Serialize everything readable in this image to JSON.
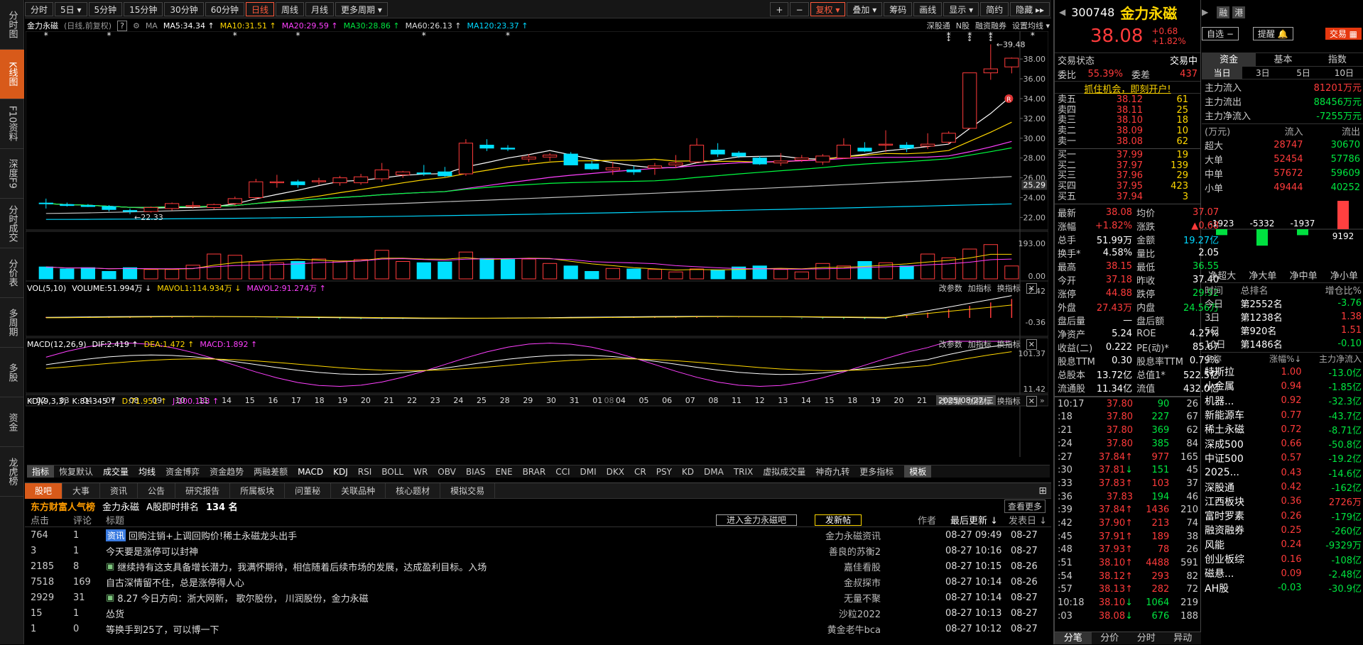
{
  "left_tabs": [
    "分时图",
    "K线图",
    "F10资料",
    "深度F9",
    "分时成交",
    "分价表",
    "多周期",
    "多股",
    "资金",
    "龙虎榜"
  ],
  "toolbar": {
    "periods": [
      "分时",
      "5日 ▾",
      "5分钟",
      "15分钟",
      "30分钟",
      "60分钟",
      "日线",
      "周线",
      "月线",
      "更多周期 ▾"
    ],
    "right": [
      "+",
      "−",
      "复权 ▾",
      "叠加 ▾",
      "筹码",
      "画线",
      "显示 ▾",
      "简约",
      "隐藏 ▸▸"
    ]
  },
  "ma_line": {
    "name": "金力永磁",
    "mode": "(日线,前复权)",
    "help": "?",
    "ma": "MA",
    "ma5": "MA5:34.34 ↑",
    "ma10": "MA10:31.51 ↑",
    "ma20": "MA20:29.59 ↑",
    "ma30": "MA30:28.86 ↑",
    "ma60": "MA60:26.13 ↑",
    "ma120": "MA120:23.37 ↑",
    "right": [
      "深股通",
      "N股",
      "融资融券",
      "设置均线 ▾"
    ]
  },
  "chart_data": {
    "type": "candlestick",
    "title": "金力永磁(日线,前复权)",
    "y_ticks": [
      38.0,
      36.0,
      34.0,
      32.0,
      30.0,
      28.0,
      26.0,
      24.0,
      22.0
    ],
    "y_current": "25.29",
    "high_label": "39.48",
    "low_label": "22.33",
    "x_ticks": [
      "02",
      "03",
      "04",
      "07",
      "08",
      "09",
      "10",
      "11",
      "14",
      "15",
      "16",
      "17",
      "18",
      "19",
      "20",
      "21",
      "22",
      "23",
      "24",
      "25",
      "28",
      "29",
      "30",
      "31",
      "01",
      "04",
      "05",
      "06",
      "07",
      "08",
      "11",
      "12",
      "13",
      "14",
      "15",
      "18",
      "19",
      "20",
      "21",
      "22",
      "25"
    ],
    "x_month_mark": "08",
    "x_cursor": "2025/08/27/三",
    "ma_colors": {
      "ma5": "#ffffff",
      "ma10": "#ffd700",
      "ma20": "#ff40ff",
      "ma30": "#00ff40",
      "ma60": "#c0c0c0",
      "ma120": "#00d8ff"
    },
    "candles": [
      [
        23.45,
        23.9,
        22.9,
        23.4
      ],
      [
        23.3,
        23.5,
        23.1,
        23.2
      ],
      [
        23.2,
        23.35,
        23.05,
        23.1
      ],
      [
        23.1,
        23.25,
        22.6,
        22.8
      ],
      [
        22.7,
        22.9,
        22.33,
        22.6
      ],
      [
        22.6,
        23.1,
        22.5,
        23.0
      ],
      [
        22.9,
        23.5,
        22.7,
        23.4
      ],
      [
        23.1,
        23.6,
        22.9,
        23.2
      ],
      [
        23.0,
        23.4,
        22.8,
        23.3
      ],
      [
        23.4,
        24.1,
        23.2,
        23.9
      ],
      [
        24.0,
        25.9,
        23.8,
        25.6
      ],
      [
        25.5,
        26.3,
        25.0,
        25.6
      ],
      [
        25.6,
        25.8,
        25.0,
        25.3
      ],
      [
        25.6,
        26.0,
        25.3,
        25.7
      ],
      [
        25.5,
        26.2,
        25.2,
        26.0
      ],
      [
        25.5,
        26.4,
        25.3,
        26.1
      ],
      [
        25.9,
        27.5,
        25.6,
        26.8
      ],
      [
        26.3,
        26.7,
        26.0,
        26.6
      ],
      [
        26.5,
        27.3,
        26.2,
        26.4
      ],
      [
        26.6,
        27.1,
        26.1,
        26.2
      ],
      [
        26.4,
        29.9,
        26.2,
        29.5
      ],
      [
        29.3,
        29.9,
        28.7,
        29.0
      ],
      [
        29.0,
        29.3,
        28.7,
        28.9
      ],
      [
        27.9,
        28.4,
        27.6,
        28.1
      ],
      [
        28.1,
        28.5,
        27.7,
        28.3
      ],
      [
        28.4,
        28.6,
        27.5,
        27.3
      ],
      [
        27.4,
        27.7,
        26.8,
        26.9
      ],
      [
        26.8,
        27.6,
        26.3,
        27.0
      ],
      [
        26.8,
        27.2,
        26.3,
        26.6
      ],
      [
        27.0,
        27.5,
        26.3,
        27.2
      ],
      [
        27.3,
        28.3,
        27.0,
        27.5
      ],
      [
        27.6,
        30.0,
        27.5,
        29.3
      ],
      [
        28.8,
        29.5,
        28.1,
        28.4
      ],
      [
        28.5,
        28.7,
        28.0,
        28.2
      ],
      [
        28.0,
        28.2,
        27.3,
        27.4
      ],
      [
        27.5,
        28.5,
        27.2,
        27.7
      ],
      [
        27.8,
        28.3,
        27.6,
        28.0
      ],
      [
        27.6,
        28.4,
        27.3,
        28.2
      ],
      [
        28.0,
        30.0,
        27.9,
        29.3
      ],
      [
        29.0,
        29.6,
        28.6,
        28.7
      ],
      [
        29.3,
        30.8,
        28.6,
        29.4
      ],
      [
        29.3,
        29.6,
        28.6,
        29.0
      ],
      [
        29.2,
        30.5,
        28.9,
        29.4
      ],
      [
        29.6,
        30.7,
        29.4,
        30.5
      ],
      [
        31.0,
        36.6,
        30.9,
        36.6
      ],
      [
        36.6,
        39.48,
        35.9,
        37.0
      ],
      [
        37.2,
        38.15,
        36.55,
        38.08
      ]
    ],
    "flags_x": [
      0,
      3,
      9,
      12,
      18,
      22,
      43,
      44,
      45,
      47
    ],
    "vol": {
      "label": "VOL(5,10)",
      "volume": "VOLUME:51.994万 ↓",
      "mavol1": "MAVOL1:114.934万 ↓",
      "mavol2": "MAVOL2:91.274万 ↑",
      "ticks": [
        "193.00",
        "0.00"
      ],
      "values": [
        48,
        40,
        45,
        30,
        45,
        38,
        38,
        55,
        100,
        95,
        68,
        65,
        70,
        80,
        72,
        78,
        115,
        70,
        65,
        68,
        108,
        82,
        78,
        80,
        62,
        52,
        30,
        42,
        40,
        38,
        28,
        40,
        35,
        48,
        52,
        38,
        28,
        62,
        52,
        70,
        65,
        52,
        100,
        85,
        120,
        138,
        52
      ]
    },
    "macd": {
      "label": "MACD(12,26,9)",
      "dif": "DIF:2.419 ↑",
      "dea": "DEA:1.472 ↑",
      "macd": "MACD:1.892 ↑",
      "ticks": [
        "2.42",
        "-0.36"
      ]
    },
    "kdj": {
      "label": "KDJ(9,3,3)",
      "k": "K:81.345 ↑",
      "d": "D:71.951 ↑",
      "j": "J:100.133 ↑",
      "ticks": [
        "101.37",
        "11.42"
      ]
    },
    "panel_btns": [
      "改参数",
      "加指标",
      "换指标"
    ]
  },
  "indicator_tabs": [
    "指标",
    "恢复默认",
    "成交量",
    "均线",
    "资金博弈",
    "资金趋势",
    "两融差额",
    "MACD",
    "KDJ",
    "RSI",
    "BOLL",
    "WR",
    "OBV",
    "BIAS",
    "ENE",
    "BRAR",
    "CCI",
    "DMI",
    "DKX",
    "CR",
    "PSY",
    "KD",
    "DMA",
    "TRIX",
    "虚拟成交量",
    "神奇九转",
    "更多指标",
    "模板"
  ],
  "forum": {
    "tabs": [
      "股吧",
      "大事",
      "资讯",
      "公告",
      "研究报告",
      "所属板块",
      "问董秘",
      "关联品种",
      "核心题材",
      "模拟交易"
    ],
    "rank_title": "东方财富人气榜",
    "rank_stock": "金力永磁",
    "rank_label": "A股即时排名",
    "rank": "134 名",
    "see_more": "查看更多",
    "cols": [
      "点击",
      "评论",
      "标题",
      "作者",
      "最后更新 ↓",
      "发表日 ↓"
    ],
    "enter_btn": "进入金力永磁吧",
    "post_btn": "发新帖",
    "posts": [
      {
        "clicks": "764",
        "comments": "1",
        "tag": "资讯",
        "title": "回购注销+上调回购价!稀土永磁龙头出手",
        "author": "金力永磁资讯",
        "update": "08-27 09:49",
        "date": "08-27"
      },
      {
        "clicks": "3",
        "comments": "1",
        "tag": "",
        "title": "今天要是涨停可以封神",
        "author": "善良的苏衡2",
        "update": "08-27 10:16",
        "date": "08-27"
      },
      {
        "clicks": "2185",
        "comments": "8",
        "tag": "img",
        "title": "继续持有这支具备增长潜力，我满怀期待，相信随着后续市场的发展，达成盈利目标。入场",
        "author": "嘉佳看股",
        "update": "08-27 10:15",
        "date": "08-26"
      },
      {
        "clicks": "7518",
        "comments": "169",
        "tag": "",
        "title": "自古深情留不住，总是涨停得人心",
        "author": "金叔探市",
        "update": "08-27 10:14",
        "date": "08-26"
      },
      {
        "clicks": "2929",
        "comments": "31",
        "tag": "img",
        "title": "8.27   今日方向：浙大网新，  歌尔股份，  川润股份，金力永磁",
        "author": "无量不聚",
        "update": "08-27 10:14",
        "date": "08-27"
      },
      {
        "clicks": "15",
        "comments": "1",
        "tag": "",
        "title": "怂货",
        "author": "沙粒2022",
        "update": "08-27 10:13",
        "date": "08-27"
      },
      {
        "clicks": "1",
        "comments": "0",
        "tag": "",
        "title": "等换手到25了，可以博一下",
        "author": "黄金老牛bca",
        "update": "08-27 10:12",
        "date": "08-27"
      }
    ]
  },
  "quote": {
    "code": "300748",
    "name": "金力永磁",
    "badges": [
      "融",
      "港"
    ],
    "price": "38.08",
    "change": "+0.68",
    "pct": "+1.82%",
    "self_select": "自选 −",
    "alert": "提醒 🔔",
    "trade": "交易 ▦",
    "status_label": "交易状态",
    "status": "交易中",
    "wb_label": "委比",
    "wb": "55.39%",
    "wc_label": "委差",
    "wc": "437",
    "promo": "抓住机会，即刻开户!",
    "asks": [
      [
        "卖五",
        "38.12",
        "61"
      ],
      [
        "卖四",
        "38.11",
        "25"
      ],
      [
        "卖三",
        "38.10",
        "18"
      ],
      [
        "卖二",
        "38.09",
        "10"
      ],
      [
        "卖一",
        "38.08",
        "62"
      ]
    ],
    "bids": [
      [
        "买一",
        "37.99",
        "19"
      ],
      [
        "买二",
        "37.97",
        "139"
      ],
      [
        "买三",
        "37.96",
        "29"
      ],
      [
        "买四",
        "37.95",
        "423"
      ],
      [
        "买五",
        "37.94",
        "3"
      ]
    ],
    "stats": [
      [
        "最新",
        "38.08",
        "均价",
        "37.07"
      ],
      [
        "涨幅",
        "+1.82%",
        "涨跌",
        "▲0.68"
      ],
      [
        "总手",
        "51.99万",
        "金额",
        "19.27亿"
      ],
      [
        "换手*",
        "4.58%",
        "量比",
        "2.05"
      ],
      [
        "最高",
        "38.15",
        "最低",
        "36.55"
      ],
      [
        "今开",
        "37.18",
        "昨收",
        "37.40"
      ],
      [
        "涨停",
        "44.88",
        "跌停",
        "29.92"
      ],
      [
        "外盘",
        "27.43万",
        "内盘",
        "24.56万"
      ],
      [
        "盘后量",
        "—",
        "盘后额",
        "—"
      ],
      [
        "净资产",
        "5.24",
        "ROE",
        "4.27%"
      ],
      [
        "收益(二)",
        "0.222",
        "PE(动)*",
        "85.67"
      ],
      [
        "股息TTM",
        "0.30",
        "股息率TTM",
        "0.79%"
      ],
      [
        "总股本",
        "13.72亿",
        "总值1*",
        "522.5亿"
      ],
      [
        "流通股",
        "11.34亿",
        "流值",
        "432.0亿"
      ]
    ],
    "ticks": [
      [
        "10:17",
        "37.80",
        "",
        90,
        "26",
        "g"
      ],
      [
        ":18",
        "37.80",
        "",
        227,
        "67",
        "g"
      ],
      [
        ":21",
        "37.80",
        "",
        369,
        "62",
        "g"
      ],
      [
        ":24",
        "37.80",
        "",
        385,
        "84",
        "g"
      ],
      [
        ":27",
        "37.84",
        "↑",
        977,
        "165",
        "r"
      ],
      [
        ":30",
        "37.81",
        "↓",
        151,
        "45",
        "g"
      ],
      [
        ":33",
        "37.83",
        "↑",
        103,
        "37",
        "r"
      ],
      [
        ":36",
        "37.83",
        "",
        194,
        "46",
        "g"
      ],
      [
        ":39",
        "37.84",
        "↑",
        1436,
        "210",
        "r"
      ],
      [
        ":42",
        "37.90",
        "↑",
        213,
        "74",
        "r"
      ],
      [
        ":45",
        "37.91",
        "↑",
        189,
        "38",
        "r"
      ],
      [
        ":48",
        "37.93",
        "↑",
        78,
        "26",
        "r"
      ],
      [
        ":51",
        "38.10",
        "↑",
        4488,
        "591",
        "r"
      ],
      [
        ":54",
        "38.12",
        "↑",
        293,
        "82",
        "r"
      ],
      [
        ":57",
        "38.13",
        "↑",
        282,
        "72",
        "r"
      ],
      [
        "10:18",
        "38.10",
        "↓",
        1064,
        "219",
        "g"
      ],
      [
        ":03",
        "38.08",
        "↓",
        676,
        "188",
        "g"
      ]
    ],
    "bottom_tabs": [
      "分笔",
      "分价",
      "分时",
      "异动"
    ]
  },
  "funds": {
    "tabs": [
      "资金",
      "基本",
      "指数"
    ],
    "sub": [
      "当日",
      "3日",
      "5日",
      "10日"
    ],
    "main_in_label": "主力流入",
    "main_in": "81201万元",
    "main_out_label": "主力流出",
    "main_out": "88456万元",
    "main_net_label": "主力净流入",
    "main_net": "-7255万元",
    "tbl_head": [
      "(万元)",
      "流入",
      "流出"
    ],
    "tbl": [
      [
        "超大",
        "28747",
        "30670"
      ],
      [
        "大单",
        "52454",
        "57786"
      ],
      [
        "中单",
        "57672",
        "59609"
      ],
      [
        "小单",
        "49444",
        "40252"
      ]
    ],
    "net_values": [
      -1923,
      -5332,
      -1937,
      9192
    ],
    "net_labels": [
      "净超大",
      "净大单",
      "净中单",
      "净小单"
    ],
    "rank_head": [
      "时间",
      "总排名",
      "增仓比%"
    ],
    "ranks": [
      [
        "今日",
        "第2552名",
        "-3.76"
      ],
      [
        "3日",
        "第1238名",
        "1.38"
      ],
      [
        "5日",
        "第920名",
        "1.51"
      ],
      [
        "10日",
        "第1486名",
        "-0.10"
      ]
    ],
    "sector_head": [
      "名称",
      "涨幅%↓",
      "主力净流入"
    ],
    "sectors": [
      [
        "特斯拉",
        "1.00",
        "-13.0亿"
      ],
      [
        "小金属",
        "0.94",
        "-1.85亿"
      ],
      [
        "机器...",
        "0.92",
        "-32.3亿"
      ],
      [
        "新能源车",
        "0.77",
        "-43.7亿"
      ],
      [
        "稀土永磁",
        "0.72",
        "-8.71亿"
      ],
      [
        "深成500",
        "0.66",
        "-50.8亿"
      ],
      [
        "中证500",
        "0.57",
        "-19.2亿"
      ],
      [
        "2025...",
        "0.43",
        "-14.6亿"
      ],
      [
        "深股通",
        "0.42",
        "-162亿"
      ],
      [
        "江西板块",
        "0.36",
        "2726万"
      ],
      [
        "富时罗素",
        "0.26",
        "-179亿"
      ],
      [
        "融资融券",
        "0.25",
        "-260亿"
      ],
      [
        "风能",
        "0.24",
        "-9329万"
      ],
      [
        "创业板综",
        "0.16",
        "-108亿"
      ],
      [
        "磁悬...",
        "0.09",
        "-2.48亿"
      ],
      [
        "AH股",
        "-0.03",
        "-30.9亿"
      ]
    ]
  }
}
